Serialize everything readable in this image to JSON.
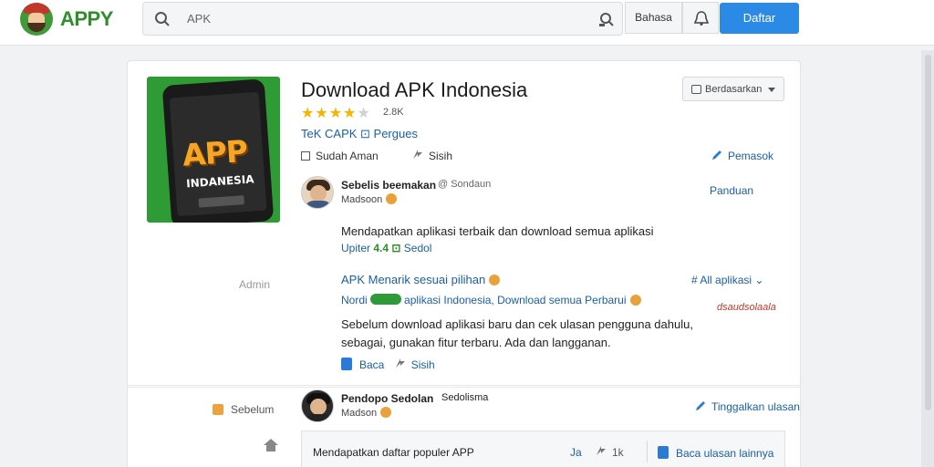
{
  "header": {
    "logo_text": "APPY",
    "search_text": "APK",
    "language_button": "Bahasa",
    "primary_button": "Daftar"
  },
  "app": {
    "image_title": "APP",
    "image_subtitle": "INDANESIA",
    "title": "Download APK Indonesia",
    "rating_value": "2.8K",
    "stars_filled": 4,
    "stars_total": 5,
    "developer": "TeK CAPK ⊡ Pergues",
    "sort_label": "Berdasarkan",
    "meta_left": "Sudah Aman",
    "meta_mid": "Sisih",
    "share_link": "Pemasok",
    "report_link": "Panduan"
  },
  "comment1": {
    "name": "Sebelis beemakan",
    "handle": "@ Sondaun",
    "role": "Madsoon",
    "line1": "Mendapatkan aplikasi terbaik dan download semua aplikasi",
    "line2_lead": "Upiter",
    "line2_green": "4.4 ⊡",
    "line2_tail": "Sedol",
    "left_label": "Admin",
    "sub_title": "APK Menarik sesuai pilihan",
    "sub_right": "# All aplikasi",
    "sub_line_lead": "Nordi",
    "sub_line_tail": "aplikasi Indonesia, Download semua Perbarui",
    "sub_stamp": "dsaudsolaala",
    "body1": "Sebelum download aplikasi baru dan cek ulasan pengguna dahulu,",
    "body2": "sebagai, gunakan fitur terbaru. Ada dan langganan.",
    "action1": "Baca",
    "action2": "Sisih"
  },
  "comment2": {
    "name": "Pendopo Sedolan",
    "handle": "Sedolisma",
    "role": "Madson",
    "left_label": "Sebelum",
    "reply_link": "Tinggalkan ulasan",
    "box_text": "Mendapatkan daftar populer APP",
    "box_mid": "Ja",
    "box_mid2": "1k",
    "box_right": "Baca ulasan lainnya"
  }
}
